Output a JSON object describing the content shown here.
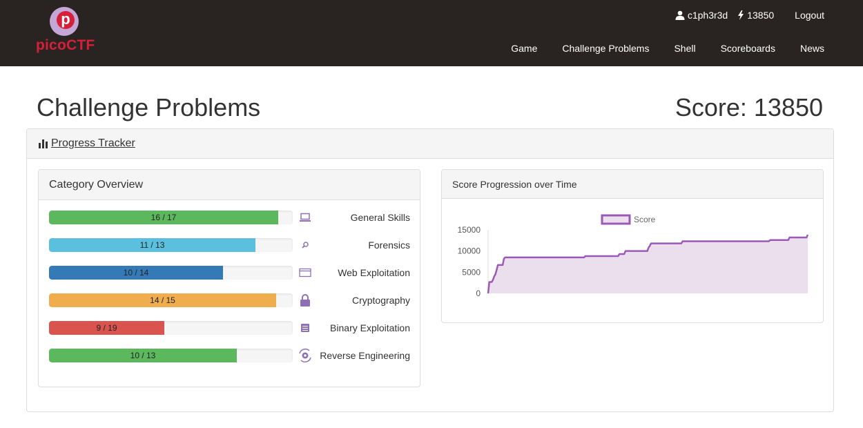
{
  "brand": {
    "logo_letter": "p",
    "logo_text": "picoCTF"
  },
  "nav": {
    "user": "c1ph3r3d",
    "points": "13850",
    "logout": "Logout",
    "links": [
      "Game",
      "Challenge Problems",
      "Shell",
      "Scoreboards",
      "News"
    ]
  },
  "page": {
    "title": "Challenge Problems",
    "score": "Score: 13850"
  },
  "tracker": {
    "title": "Progress Tracker"
  },
  "categories": {
    "title": "Category Overview",
    "items": [
      {
        "name": "General Skills",
        "label": "16 / 17",
        "solved": 16,
        "total": 17,
        "color": "#5cb85c",
        "icon": "laptop-icon"
      },
      {
        "name": "Forensics",
        "label": "11 / 13",
        "solved": 11,
        "total": 13,
        "color": "#5bc0de",
        "icon": "magnifier-icon"
      },
      {
        "name": "Web Exploitation",
        "label": "10 / 14",
        "solved": 10,
        "total": 14,
        "color": "#337ab7",
        "icon": "browser-window-icon"
      },
      {
        "name": "Cryptography",
        "label": "14 / 15",
        "solved": 14,
        "total": 15,
        "color": "#f0ad4e",
        "icon": "lock-icon"
      },
      {
        "name": "Binary Exploitation",
        "label": "9 / 19",
        "solved": 9,
        "total": 19,
        "color": "#d9534f",
        "icon": "binary-chip-icon"
      },
      {
        "name": "Reverse Engineering",
        "label": "10 / 13",
        "solved": 10,
        "total": 13,
        "color": "#5cb85c",
        "icon": "gear-cycle-icon"
      }
    ]
  },
  "chart_data": {
    "type": "area",
    "title": "Score Progression over Time",
    "series": [
      {
        "name": "Score",
        "color": "#9b59b6",
        "fill": "#ebdfee",
        "values": [
          0,
          2700,
          2700,
          2700,
          3200,
          4000,
          4500,
          5500,
          6700,
          6700,
          6700,
          6700,
          6700,
          8200,
          8500,
          8500,
          8500,
          8500,
          8500,
          8500,
          8500,
          8500,
          8500,
          8500,
          8500,
          8500,
          8500,
          8500,
          8500,
          8500,
          8500,
          8500,
          8500,
          8500,
          8500,
          8500,
          8500,
          8500,
          8500,
          8500,
          8500,
          8500,
          8500,
          8500,
          8500,
          8500,
          8500,
          8500,
          8500,
          8500,
          8500,
          8500,
          8500,
          8500,
          8500,
          8500,
          8500,
          8500,
          8500,
          8500,
          8500,
          8500,
          8500,
          8500,
          8500,
          8500,
          8500,
          8500,
          8500,
          8500,
          8500,
          8500,
          8500,
          8500,
          8500,
          8500,
          8500,
          8500,
          8500,
          8500,
          8800,
          8800,
          8800,
          8800,
          8800,
          8800,
          8800,
          8800,
          8800,
          8800,
          8800,
          8800,
          8800,
          8800,
          8800,
          8800,
          8800,
          8800,
          8800,
          8800,
          8800,
          8800,
          8800,
          8800,
          8800,
          8800,
          8800,
          8800,
          9300,
          9300,
          9300,
          9300,
          9300,
          10000,
          10000,
          10000,
          10000,
          10000,
          10000,
          10000,
          10000,
          10000,
          10000,
          10000,
          10000,
          10000,
          10000,
          10000,
          10000,
          10000,
          10000,
          10000,
          10800,
          11200,
          11800,
          11800,
          11800,
          11800,
          11800,
          11800,
          11800,
          11800,
          11800,
          11800,
          11800,
          11800,
          11800,
          11800,
          11800,
          11800,
          11800,
          11800,
          11800,
          11800,
          11800,
          11800,
          11800,
          11800,
          11800,
          11800,
          12300,
          12300,
          12300,
          12300,
          12300,
          12300,
          12300,
          12300,
          12300,
          12300,
          12300,
          12300,
          12300,
          12300,
          12300,
          12300,
          12300,
          12300,
          12300,
          12300,
          12300,
          12300,
          12300,
          12300,
          12300,
          12300,
          12300,
          12300,
          12300,
          12300,
          12300,
          12300,
          12300,
          12300,
          12300,
          12300,
          12300,
          12300,
          12300,
          12300,
          12300,
          12300,
          12300,
          12300,
          12300,
          12300,
          12300,
          12300,
          12300,
          12300,
          12300,
          12300,
          12300,
          12300,
          12300,
          12300,
          12300,
          12300,
          12300,
          12300,
          12300,
          12300,
          12300,
          12300,
          12300,
          12300,
          12300,
          12300,
          12300,
          12300,
          12300,
          12300,
          12600,
          12600,
          12600,
          12600,
          12600,
          12600,
          12600,
          12600,
          12600,
          12600,
          12600,
          12600,
          12600,
          12600,
          12600,
          12600,
          13200,
          13200,
          13200,
          13200,
          13200,
          13200,
          13200,
          13200,
          13200,
          13200,
          13200,
          13200,
          13200,
          13200,
          13200,
          13850
        ]
      }
    ],
    "ylim": [
      0,
      15000
    ],
    "yticks": [
      15000,
      10000,
      5000,
      0
    ],
    "legend_position": "top-center",
    "grid": false
  }
}
